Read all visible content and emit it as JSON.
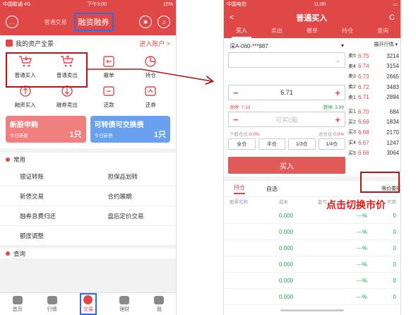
{
  "left": {
    "status": {
      "carrier": "中国联通 4G",
      "time": "下午3:00",
      "battery": "15%"
    },
    "header": {
      "tab_normal": "普通交易",
      "tab_margin": "融资融券"
    },
    "asset": {
      "title": "我的资产全景",
      "link": "进入账户 >"
    },
    "grid": [
      {
        "label": "普通买入",
        "icon": "cart-in-icon"
      },
      {
        "label": "普通卖出",
        "icon": "cart-out-icon"
      },
      {
        "label": "撤单",
        "icon": "cancel-icon"
      },
      {
        "label": "持仓",
        "icon": "pie-icon"
      },
      {
        "label": "融资买入",
        "icon": "finance-buy-icon"
      },
      {
        "label": "融券卖出",
        "icon": "short-sell-icon"
      },
      {
        "label": "还款",
        "icon": "repay-icon"
      },
      {
        "label": "还券",
        "icon": "return-stock-icon"
      }
    ],
    "banners": {
      "ipo_title": "新股申购",
      "ipo_sub": "今日新股",
      "ipo_count": "1只",
      "cb_title": "可转债可交换债",
      "cb_sub": "今日新债",
      "cb_count": "1只"
    },
    "common": {
      "title": "常用",
      "items": [
        "银证转账",
        "担保品划转",
        "新债交易",
        "合约展期",
        "融券息费归还",
        "盘后定价交易",
        "额度调整"
      ]
    },
    "query": {
      "title": "查询"
    },
    "tabbar": [
      "首页",
      "行情",
      "交易",
      "理财",
      "我"
    ]
  },
  "right": {
    "status": {
      "carrier": "中国电信",
      "time": "11:00",
      "battery": ""
    },
    "header": {
      "title": "普通买入",
      "back": "<",
      "refresh": "C"
    },
    "tabs": [
      "买入",
      "卖出",
      "撤单",
      "持仓",
      "查询"
    ],
    "account": "深A-060-***887",
    "price": "6.71",
    "limit_up_label": "涨停:",
    "limit_up": "7.33",
    "limit_down_label": "跌停:",
    "limit_down": "5.99",
    "qty_placeholder": "可买0股",
    "afford_label": "个股仓位:",
    "afford_val": "0.0%",
    "total_label": "总仓位:",
    "total_val": "0.0%",
    "pos_buttons": [
      "全仓",
      "半仓",
      "1/3仓",
      "1/4仓"
    ],
    "buy_label": "买入",
    "quote_header": "展开行情",
    "asks": [
      {
        "label": "卖5",
        "price": "6.75",
        "vol": "3214"
      },
      {
        "label": "卖4",
        "price": "6.74",
        "vol": "3154"
      },
      {
        "label": "卖3",
        "price": "6.73",
        "vol": "2665"
      },
      {
        "label": "卖2",
        "price": "6.72",
        "vol": "3483"
      },
      {
        "label": "卖1",
        "price": "6.71",
        "vol": "2894"
      }
    ],
    "bids": [
      {
        "label": "买1",
        "price": "6.70",
        "vol": "684"
      },
      {
        "label": "买2",
        "price": "6.69",
        "vol": "1834"
      },
      {
        "label": "买3",
        "price": "6.68",
        "vol": "2170"
      },
      {
        "label": "买4",
        "price": "6.67",
        "vol": "1247"
      },
      {
        "label": "买5",
        "price": "6.66",
        "vol": "3064"
      }
    ],
    "pos_tab_hold": "持仓",
    "pos_tab_fav": "自选",
    "limit_order": "限价委托 ▼",
    "pos_columns": [
      "股票名称",
      "成本",
      "盈亏",
      "可用"
    ],
    "rows": [
      {
        "cost": "0.000",
        "pct": "---%",
        "avail": "0"
      },
      {
        "cost": "0.000",
        "pct": "---%",
        "avail": "0"
      },
      {
        "cost": "0.000",
        "pct": "---%",
        "avail": "0"
      },
      {
        "cost": "0.000",
        "pct": "---%",
        "avail": "0"
      },
      {
        "cost": "0.000",
        "pct": "---%",
        "avail": "0"
      },
      {
        "cost": "0.000",
        "pct": "---%",
        "avail": "0"
      }
    ]
  },
  "annotation": "点击切换市价"
}
